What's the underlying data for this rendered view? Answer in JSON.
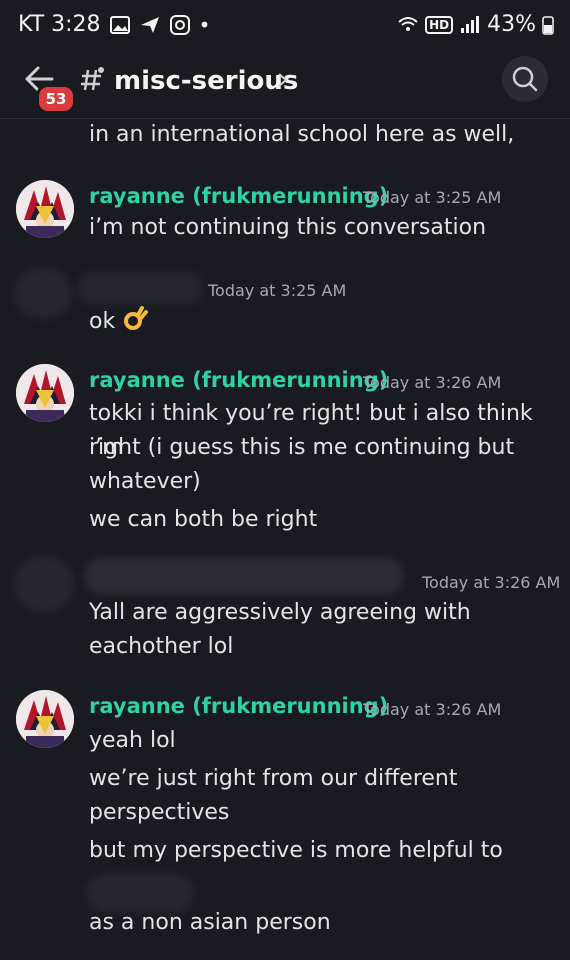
{
  "status": {
    "carrier_time": "KT 3:28",
    "battery": "43%",
    "hd": "HD"
  },
  "header": {
    "back_badge": "53",
    "channel_name": "misc-serious"
  },
  "messages": [
    {
      "lines": [
        "in an international school here as well,"
      ]
    },
    {
      "author": "rayanne (frukmerunning)",
      "time": "Today at 3:25 AM",
      "lines": [
        "i’m not continuing this conversation"
      ]
    },
    {
      "time": "Today at 3:25 AM",
      "lines": [
        "ok"
      ]
    },
    {
      "author": "rayanne (frukmerunning)",
      "time": "Today at 3:26 AM",
      "lines": [
        "tokki i think you’re right! but i also think i’m",
        "right (i guess this is me continuing but",
        "whatever)",
        "we can both be right"
      ]
    },
    {
      "time": "Today at 3:26 AM",
      "lines": [
        "Yall are aggressively agreeing with",
        "eachother lol"
      ]
    },
    {
      "author": "rayanne (frukmerunning)",
      "time": "Today at 3:26 AM",
      "lines": [
        "yeah lol",
        "we’re just right from our different",
        "perspectives",
        "but my perspective is more helpful to",
        "as a non asian person"
      ]
    }
  ]
}
